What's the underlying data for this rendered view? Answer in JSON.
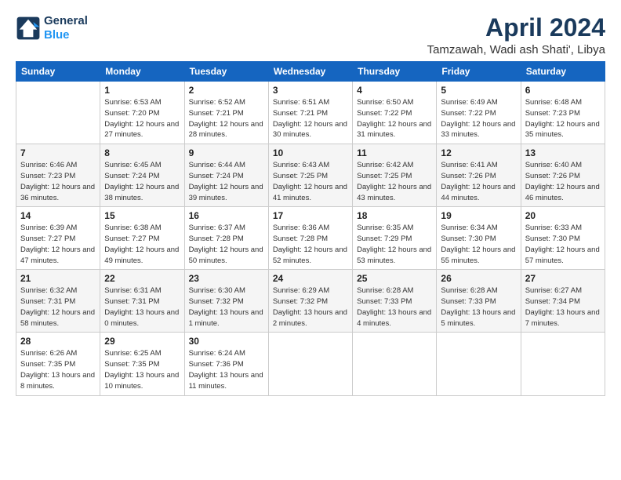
{
  "header": {
    "logo_line1": "General",
    "logo_line2": "Blue",
    "month_title": "April 2024",
    "location": "Tamzawah, Wadi ash Shati', Libya"
  },
  "columns": [
    "Sunday",
    "Monday",
    "Tuesday",
    "Wednesday",
    "Thursday",
    "Friday",
    "Saturday"
  ],
  "weeks": [
    [
      {
        "day": "",
        "sunrise": "",
        "sunset": "",
        "daylight": ""
      },
      {
        "day": "1",
        "sunrise": "Sunrise: 6:53 AM",
        "sunset": "Sunset: 7:20 PM",
        "daylight": "Daylight: 12 hours and 27 minutes."
      },
      {
        "day": "2",
        "sunrise": "Sunrise: 6:52 AM",
        "sunset": "Sunset: 7:21 PM",
        "daylight": "Daylight: 12 hours and 28 minutes."
      },
      {
        "day": "3",
        "sunrise": "Sunrise: 6:51 AM",
        "sunset": "Sunset: 7:21 PM",
        "daylight": "Daylight: 12 hours and 30 minutes."
      },
      {
        "day": "4",
        "sunrise": "Sunrise: 6:50 AM",
        "sunset": "Sunset: 7:22 PM",
        "daylight": "Daylight: 12 hours and 31 minutes."
      },
      {
        "day": "5",
        "sunrise": "Sunrise: 6:49 AM",
        "sunset": "Sunset: 7:22 PM",
        "daylight": "Daylight: 12 hours and 33 minutes."
      },
      {
        "day": "6",
        "sunrise": "Sunrise: 6:48 AM",
        "sunset": "Sunset: 7:23 PM",
        "daylight": "Daylight: 12 hours and 35 minutes."
      }
    ],
    [
      {
        "day": "7",
        "sunrise": "Sunrise: 6:46 AM",
        "sunset": "Sunset: 7:23 PM",
        "daylight": "Daylight: 12 hours and 36 minutes."
      },
      {
        "day": "8",
        "sunrise": "Sunrise: 6:45 AM",
        "sunset": "Sunset: 7:24 PM",
        "daylight": "Daylight: 12 hours and 38 minutes."
      },
      {
        "day": "9",
        "sunrise": "Sunrise: 6:44 AM",
        "sunset": "Sunset: 7:24 PM",
        "daylight": "Daylight: 12 hours and 39 minutes."
      },
      {
        "day": "10",
        "sunrise": "Sunrise: 6:43 AM",
        "sunset": "Sunset: 7:25 PM",
        "daylight": "Daylight: 12 hours and 41 minutes."
      },
      {
        "day": "11",
        "sunrise": "Sunrise: 6:42 AM",
        "sunset": "Sunset: 7:25 PM",
        "daylight": "Daylight: 12 hours and 43 minutes."
      },
      {
        "day": "12",
        "sunrise": "Sunrise: 6:41 AM",
        "sunset": "Sunset: 7:26 PM",
        "daylight": "Daylight: 12 hours and 44 minutes."
      },
      {
        "day": "13",
        "sunrise": "Sunrise: 6:40 AM",
        "sunset": "Sunset: 7:26 PM",
        "daylight": "Daylight: 12 hours and 46 minutes."
      }
    ],
    [
      {
        "day": "14",
        "sunrise": "Sunrise: 6:39 AM",
        "sunset": "Sunset: 7:27 PM",
        "daylight": "Daylight: 12 hours and 47 minutes."
      },
      {
        "day": "15",
        "sunrise": "Sunrise: 6:38 AM",
        "sunset": "Sunset: 7:27 PM",
        "daylight": "Daylight: 12 hours and 49 minutes."
      },
      {
        "day": "16",
        "sunrise": "Sunrise: 6:37 AM",
        "sunset": "Sunset: 7:28 PM",
        "daylight": "Daylight: 12 hours and 50 minutes."
      },
      {
        "day": "17",
        "sunrise": "Sunrise: 6:36 AM",
        "sunset": "Sunset: 7:28 PM",
        "daylight": "Daylight: 12 hours and 52 minutes."
      },
      {
        "day": "18",
        "sunrise": "Sunrise: 6:35 AM",
        "sunset": "Sunset: 7:29 PM",
        "daylight": "Daylight: 12 hours and 53 minutes."
      },
      {
        "day": "19",
        "sunrise": "Sunrise: 6:34 AM",
        "sunset": "Sunset: 7:30 PM",
        "daylight": "Daylight: 12 hours and 55 minutes."
      },
      {
        "day": "20",
        "sunrise": "Sunrise: 6:33 AM",
        "sunset": "Sunset: 7:30 PM",
        "daylight": "Daylight: 12 hours and 57 minutes."
      }
    ],
    [
      {
        "day": "21",
        "sunrise": "Sunrise: 6:32 AM",
        "sunset": "Sunset: 7:31 PM",
        "daylight": "Daylight: 12 hours and 58 minutes."
      },
      {
        "day": "22",
        "sunrise": "Sunrise: 6:31 AM",
        "sunset": "Sunset: 7:31 PM",
        "daylight": "Daylight: 13 hours and 0 minutes."
      },
      {
        "day": "23",
        "sunrise": "Sunrise: 6:30 AM",
        "sunset": "Sunset: 7:32 PM",
        "daylight": "Daylight: 13 hours and 1 minute."
      },
      {
        "day": "24",
        "sunrise": "Sunrise: 6:29 AM",
        "sunset": "Sunset: 7:32 PM",
        "daylight": "Daylight: 13 hours and 2 minutes."
      },
      {
        "day": "25",
        "sunrise": "Sunrise: 6:28 AM",
        "sunset": "Sunset: 7:33 PM",
        "daylight": "Daylight: 13 hours and 4 minutes."
      },
      {
        "day": "26",
        "sunrise": "Sunrise: 6:28 AM",
        "sunset": "Sunset: 7:33 PM",
        "daylight": "Daylight: 13 hours and 5 minutes."
      },
      {
        "day": "27",
        "sunrise": "Sunrise: 6:27 AM",
        "sunset": "Sunset: 7:34 PM",
        "daylight": "Daylight: 13 hours and 7 minutes."
      }
    ],
    [
      {
        "day": "28",
        "sunrise": "Sunrise: 6:26 AM",
        "sunset": "Sunset: 7:35 PM",
        "daylight": "Daylight: 13 hours and 8 minutes."
      },
      {
        "day": "29",
        "sunrise": "Sunrise: 6:25 AM",
        "sunset": "Sunset: 7:35 PM",
        "daylight": "Daylight: 13 hours and 10 minutes."
      },
      {
        "day": "30",
        "sunrise": "Sunrise: 6:24 AM",
        "sunset": "Sunset: 7:36 PM",
        "daylight": "Daylight: 13 hours and 11 minutes."
      },
      {
        "day": "",
        "sunrise": "",
        "sunset": "",
        "daylight": ""
      },
      {
        "day": "",
        "sunrise": "",
        "sunset": "",
        "daylight": ""
      },
      {
        "day": "",
        "sunrise": "",
        "sunset": "",
        "daylight": ""
      },
      {
        "day": "",
        "sunrise": "",
        "sunset": "",
        "daylight": ""
      }
    ]
  ]
}
